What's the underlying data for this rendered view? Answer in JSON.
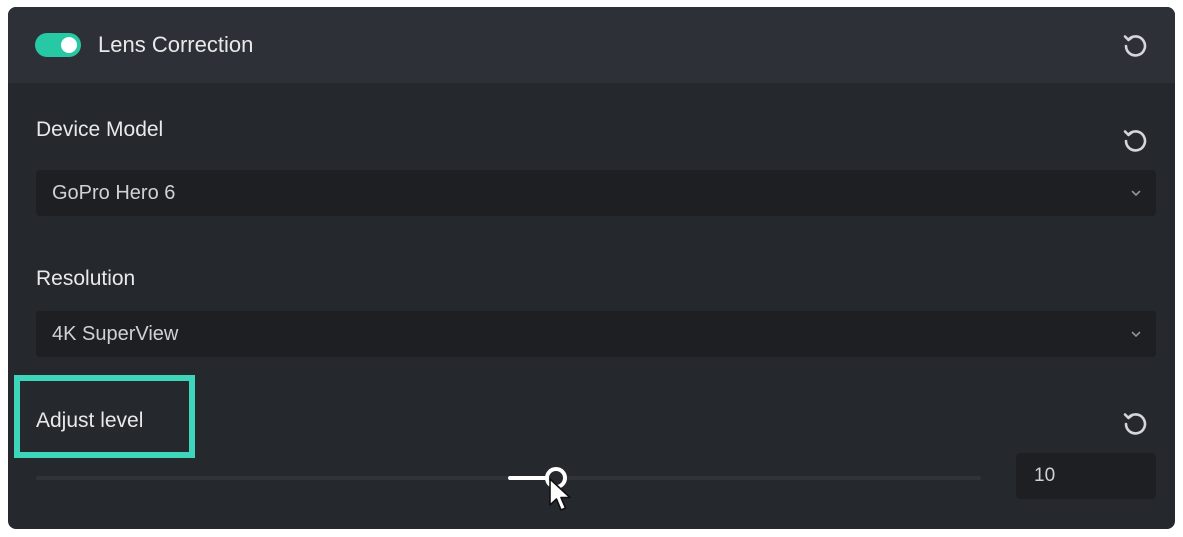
{
  "header": {
    "toggle_on": true,
    "title": "Lens Correction",
    "reset_icon": "reset-icon"
  },
  "device_model": {
    "label": "Device Model",
    "value": "GoPro Hero 6",
    "reset_icon": "reset-icon",
    "chevron_icon": "chevron-down-icon"
  },
  "resolution": {
    "label": "Resolution",
    "value": "4K SuperView",
    "chevron_icon": "chevron-down-icon"
  },
  "adjust_level": {
    "label": "Adjust level",
    "value": "10",
    "slider_fraction": 0.55,
    "reset_icon": "reset-icon",
    "highlight_color": "#3dd6bb"
  },
  "colors": {
    "accent": "#26c9a3",
    "panel_bg": "#25282d",
    "header_bg": "#2d3036",
    "field_bg": "#1d1f23"
  }
}
